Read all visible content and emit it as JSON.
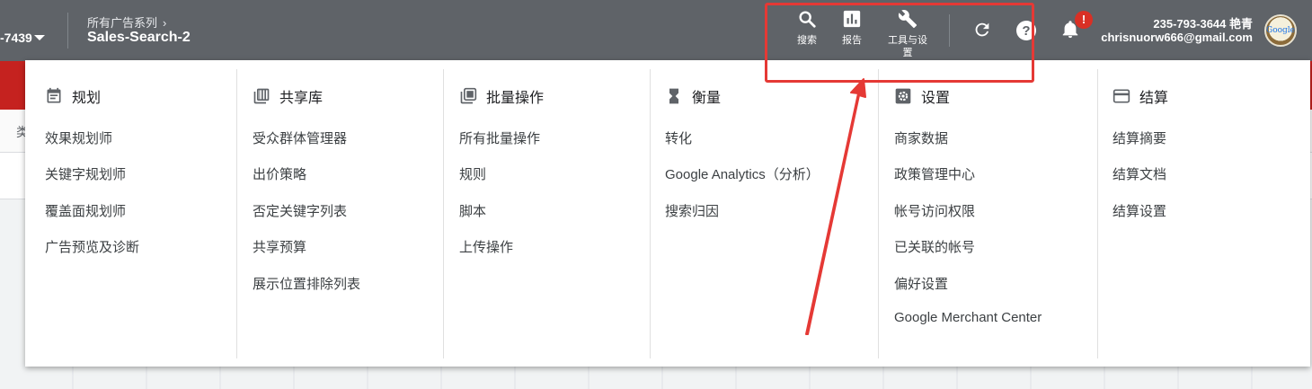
{
  "header": {
    "account_id": "-7439",
    "breadcrumb": "所有广告系列",
    "campaign_name": "Sales-Search-2",
    "tools": [
      {
        "label": "搜索",
        "icon": "search-icon"
      },
      {
        "label": "报告",
        "icon": "bar-chart-icon"
      },
      {
        "label": "工具与设置",
        "icon": "wrench-icon"
      }
    ],
    "notification_badge": "!",
    "user_phone": "235-793-3644 艳青",
    "user_email": "chrisnuorw666@gmail.com",
    "avatar_text": "Google"
  },
  "background": {
    "strip_text": "类"
  },
  "menu": {
    "columns": [
      {
        "title": "规划",
        "icon": "calendar-icon",
        "items": [
          "效果规划师",
          "关键字规划师",
          "覆盖面规划师",
          "广告预览及诊断"
        ]
      },
      {
        "title": "共享库",
        "icon": "library-icon",
        "items": [
          "受众群体管理器",
          "出价策略",
          "否定关键字列表",
          "共享预算",
          "展示位置排除列表"
        ]
      },
      {
        "title": "批量操作",
        "icon": "copy-icon",
        "items": [
          "所有批量操作",
          "规则",
          "脚本",
          "上传操作"
        ]
      },
      {
        "title": "衡量",
        "icon": "hourglass-icon",
        "items": [
          "转化",
          "Google Analytics（分析）",
          "搜索归因"
        ]
      },
      {
        "title": "设置",
        "icon": "gear-icon",
        "items": [
          "商家数据",
          "政策管理中心",
          "帐号访问权限",
          "已关联的帐号",
          "偏好设置",
          "Google Merchant Center"
        ]
      },
      {
        "title": "结算",
        "icon": "credit-card-icon",
        "items": [
          "结算摘要",
          "结算文档",
          "结算设置"
        ]
      }
    ]
  },
  "colors": {
    "header_bg": "#5f6368",
    "annotation": "#e53935",
    "badge": "#d93025"
  }
}
